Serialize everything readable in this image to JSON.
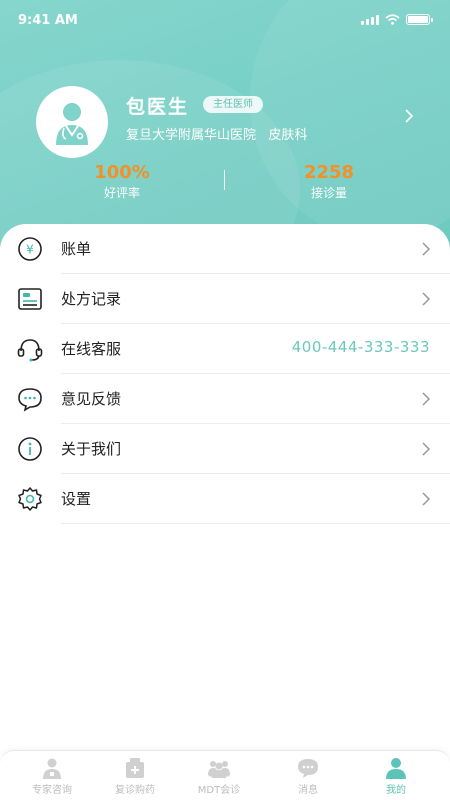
{
  "status_bar": {
    "time": "9:41 AM"
  },
  "profile": {
    "name": "包医生",
    "title_badge": "主任医师",
    "hospital_dept": "复旦大学附属华山医院   皮肤科"
  },
  "stats": [
    {
      "value": "100%",
      "label": "好评率"
    },
    {
      "value": "2258",
      "label": "接诊量"
    }
  ],
  "menu": [
    {
      "label": "账单",
      "icon": "yen-circle-icon"
    },
    {
      "label": "处方记录",
      "icon": "prescription-icon"
    },
    {
      "label": "在线客服",
      "icon": "headset-icon",
      "value": "400-444-333-333"
    },
    {
      "label": "意见反馈",
      "icon": "chat-bubble-icon"
    },
    {
      "label": "关于我们",
      "icon": "info-circle-icon"
    },
    {
      "label": "设置",
      "icon": "gear-icon"
    }
  ],
  "tabs": [
    {
      "label": "专家咨询",
      "icon": "doctor-icon"
    },
    {
      "label": "复诊购药",
      "icon": "medicine-box-icon"
    },
    {
      "label": "MDT会诊",
      "icon": "group-icon"
    },
    {
      "label": "消息",
      "icon": "message-icon"
    },
    {
      "label": "我的",
      "icon": "user-icon",
      "active": true
    }
  ],
  "colors": {
    "header": "#78d0c6",
    "accent": "#5cc3b8",
    "stat_value": "#f2902a"
  }
}
